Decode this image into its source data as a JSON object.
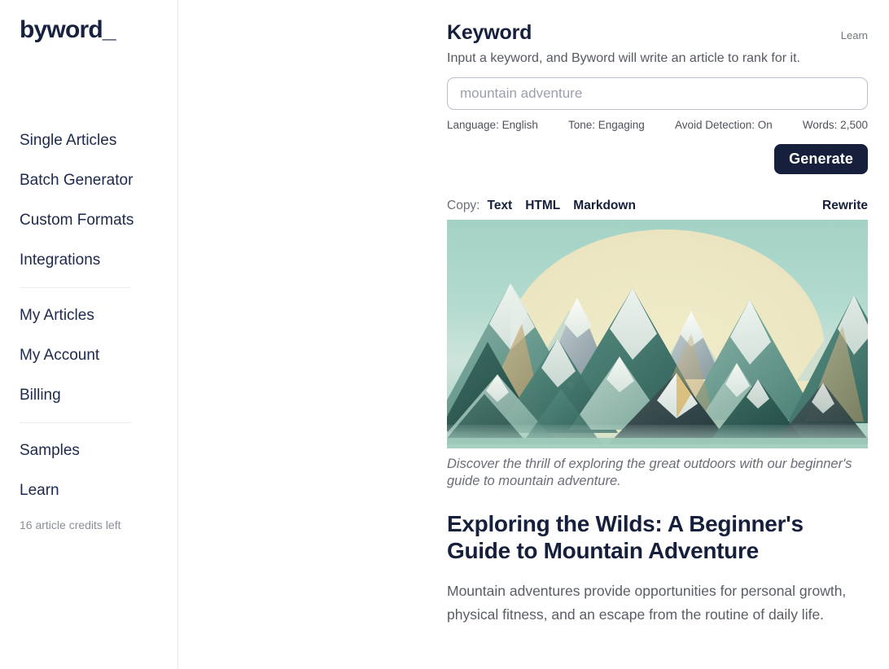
{
  "brand": {
    "logo": "byword_"
  },
  "sidebar": {
    "items_primary": [
      {
        "label": "Single Articles"
      },
      {
        "label": "Batch Generator"
      },
      {
        "label": "Custom Formats"
      },
      {
        "label": "Integrations"
      }
    ],
    "items_account": [
      {
        "label": "My Articles"
      },
      {
        "label": "My Account"
      },
      {
        "label": "Billing"
      }
    ],
    "items_resources": [
      {
        "label": "Samples"
      },
      {
        "label": "Learn"
      }
    ],
    "credits": "16 article credits left"
  },
  "keyword_panel": {
    "title": "Keyword",
    "learn_link": "Learn",
    "subtitle": "Input a keyword, and Byword will write an article to rank for it.",
    "input_value": "",
    "input_placeholder": "mountain adventure",
    "options": [
      {
        "label": "Language: English"
      },
      {
        "label": "Tone: Engaging"
      },
      {
        "label": "Avoid Detection: On"
      },
      {
        "label": "Words: 2,500"
      }
    ],
    "generate_label": "Generate"
  },
  "result_toolbar": {
    "copy_label": "Copy:",
    "copy_formats": [
      {
        "label": "Text"
      },
      {
        "label": "HTML"
      },
      {
        "label": "Markdown"
      }
    ],
    "rewrite_label": "Rewrite"
  },
  "article": {
    "image_alt": "mountain-range-illustration",
    "caption": "Discover the thrill of exploring the great outdoors with our beginner's guide to mountain adventure.",
    "title": "Exploring the Wilds: A Beginner's Guide to Mountain Adventure",
    "body": "Mountain adventures provide opportunities for personal growth, physical fitness, and an escape from the routine of daily life."
  },
  "colors": {
    "navy": "#16203c",
    "muted": "#6b7079",
    "border": "#e7e9ee",
    "sky": "#a6d3c6",
    "sun": "#ece7c4",
    "mountain_dark": "#27504b",
    "mountain_mid": "#4f8a7c",
    "mountain_light": "#9cc7ba",
    "snow": "#f2f5f0",
    "sand": "#c7ab7c"
  }
}
